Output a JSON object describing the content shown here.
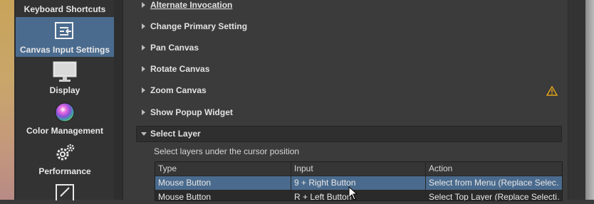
{
  "sidebar": {
    "items": [
      {
        "label": "Keyboard Shortcuts",
        "icon": "keyboard-icon"
      },
      {
        "label": "Canvas Input Settings",
        "icon": "canvas-input-icon",
        "selected": true
      },
      {
        "label": "Display",
        "icon": "monitor-icon"
      },
      {
        "label": "Color Management",
        "icon": "color-wheel-icon"
      },
      {
        "label": "Performance",
        "icon": "gears-icon"
      },
      {
        "label": "",
        "icon": "brush-icon"
      }
    ]
  },
  "actions": [
    {
      "title": "Alternate Invocation",
      "mnemonic": "A"
    },
    {
      "title": "Change Primary Setting",
      "mnemonic": "C"
    },
    {
      "title": "Pan Canvas",
      "mnemonic": "P"
    },
    {
      "title": "Rotate Canvas",
      "mnemonic": "R"
    },
    {
      "title": "Zoom Canvas",
      "mnemonic": "Z",
      "warning": true
    },
    {
      "title": "Show Popup Widget",
      "mnemonic": "S"
    }
  ],
  "expanded_action": {
    "title": "Select Layer",
    "description": "Select layers under the cursor position",
    "columns": [
      "Type",
      "Input",
      "Action"
    ],
    "rows": [
      {
        "type": "Mouse Button",
        "input": "9 + Right Button",
        "action": "Select from Menu (Replace Selec…",
        "selected": true
      },
      {
        "type": "Mouse Button",
        "input": "R + Left Button",
        "action": "Select Top Layer (Replace Selecti…"
      }
    ]
  },
  "colors": {
    "selection": "#4a6b8e",
    "warning": "#e0a21a"
  }
}
